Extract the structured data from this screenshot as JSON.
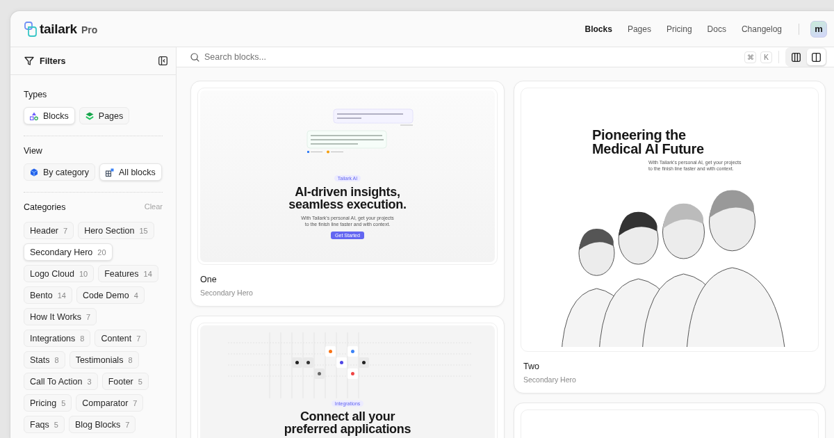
{
  "brand": {
    "name": "tailark",
    "badge": "Pro"
  },
  "nav": [
    {
      "label": "Blocks",
      "selected": true
    },
    {
      "label": "Pages",
      "selected": false
    },
    {
      "label": "Pricing",
      "selected": false
    },
    {
      "label": "Docs",
      "selected": false
    },
    {
      "label": "Changelog",
      "selected": false
    }
  ],
  "avatar": {
    "initial": "m"
  },
  "sidebar": {
    "title": "Filters",
    "types": {
      "label": "Types",
      "options": [
        {
          "kind": "blocks",
          "label": "Blocks",
          "selected": true
        },
        {
          "kind": "pages",
          "label": "Pages",
          "selected": false
        }
      ]
    },
    "view": {
      "label": "View",
      "options": [
        {
          "kind": "category",
          "label": "By category",
          "selected": false
        },
        {
          "kind": "all",
          "label": "All blocks",
          "selected": true
        }
      ]
    },
    "categories": {
      "label": "Categories",
      "clear": "Clear",
      "items": [
        {
          "label": "Header",
          "count": "7",
          "selected": false
        },
        {
          "label": "Hero Section",
          "count": "15",
          "selected": false
        },
        {
          "label": "Secondary Hero",
          "count": "20",
          "selected": true
        },
        {
          "label": "Logo Cloud",
          "count": "10",
          "selected": false
        },
        {
          "label": "Features",
          "count": "14",
          "selected": false
        },
        {
          "label": "Bento",
          "count": "14",
          "selected": false
        },
        {
          "label": "Code Demo",
          "count": "4",
          "selected": false
        },
        {
          "label": "How It Works",
          "count": "7",
          "selected": false
        },
        {
          "label": "Integrations",
          "count": "8",
          "selected": false
        },
        {
          "label": "Content",
          "count": "7",
          "selected": false
        },
        {
          "label": "Stats",
          "count": "8",
          "selected": false
        },
        {
          "label": "Testimonials",
          "count": "8",
          "selected": false
        },
        {
          "label": "Call To Action",
          "count": "3",
          "selected": false
        },
        {
          "label": "Footer",
          "count": "5",
          "selected": false
        },
        {
          "label": "Pricing",
          "count": "5",
          "selected": false
        },
        {
          "label": "Comparator",
          "count": "7",
          "selected": false
        },
        {
          "label": "Faqs",
          "count": "5",
          "selected": false
        },
        {
          "label": "Blog Blocks",
          "count": "7",
          "selected": false
        }
      ]
    }
  },
  "search": {
    "placeholder": "Search blocks...",
    "keys": [
      "⌘",
      "K"
    ],
    "layouts": [
      {
        "selected": false
      },
      {
        "selected": true
      }
    ]
  },
  "cards": [
    {
      "title": "One",
      "category": "Secondary Hero",
      "preview": {
        "kind": "ai-hero",
        "badge": "Tailark AI",
        "heading": "AI-driven insights,\nseamless execution.",
        "text": "With Tailark's personal AI, get your projects\nto the finish line faster and with context.",
        "button": "Get Started"
      }
    },
    {
      "title": "Two",
      "category": "Secondary Hero",
      "preview": {
        "kind": "image-hero",
        "heading": "Pioneering the\nMedical AI Future",
        "text": "With Tailark's personal AI, get your projects\nto the finish line faster and with context."
      }
    },
    {
      "preview": {
        "kind": "integrations",
        "badge": "Integrations",
        "heading": "Connect all your\npreferred applications"
      }
    },
    {
      "preview": {
        "kind": "blank"
      }
    }
  ]
}
